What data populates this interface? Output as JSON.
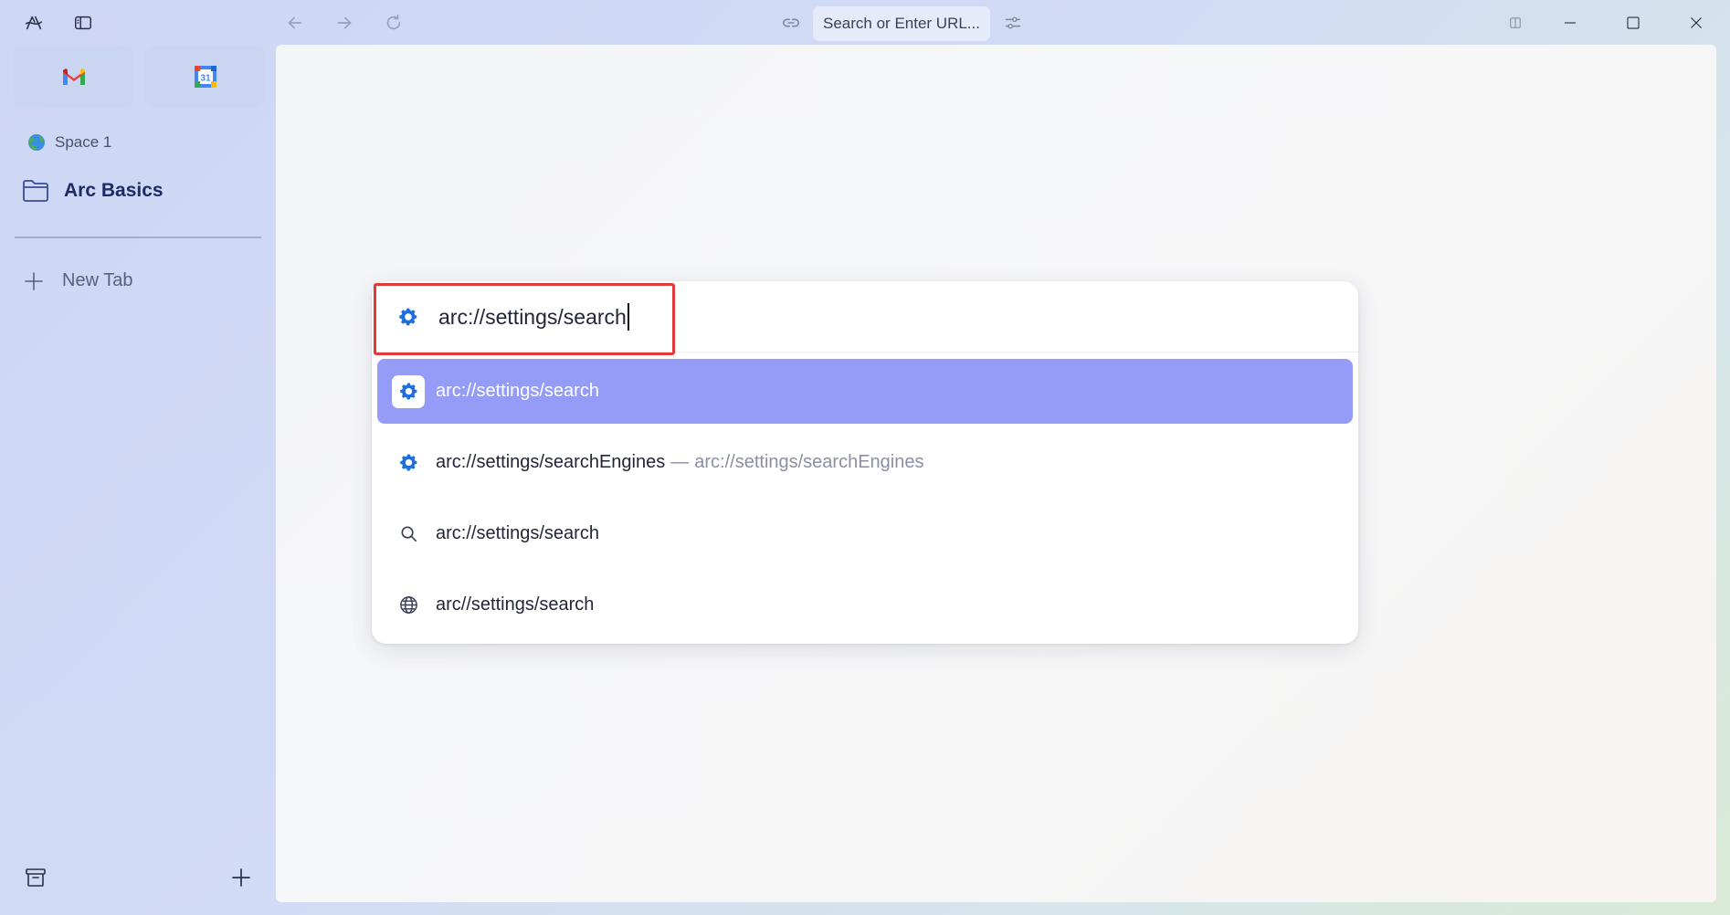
{
  "topbar": {
    "url_placeholder": "Search or Enter URL..."
  },
  "sidebar": {
    "space_name": "Space 1",
    "folder_name": "Arc Basics",
    "new_tab_label": "New Tab",
    "favorites": [
      {
        "name": "Gmail",
        "icon": "gmail-icon"
      },
      {
        "name": "Google Calendar",
        "icon": "google-calendar-icon",
        "badge": "31"
      }
    ]
  },
  "palette": {
    "input_value": "arc://settings/search",
    "results": [
      {
        "icon": "gear-icon",
        "label": "arc://settings/search",
        "selected": true
      },
      {
        "icon": "gear-icon",
        "label": "arc://settings/searchEngines",
        "separator": "—",
        "subtitle": "arc://settings/searchEngines"
      },
      {
        "icon": "search-icon",
        "label": "arc://settings/search"
      },
      {
        "icon": "globe-icon",
        "label": "arc//settings/search"
      }
    ]
  },
  "colors": {
    "accent_selected": "#959cf8",
    "gear_blue": "#1d6fe0",
    "highlight_red": "#e03a3a"
  }
}
